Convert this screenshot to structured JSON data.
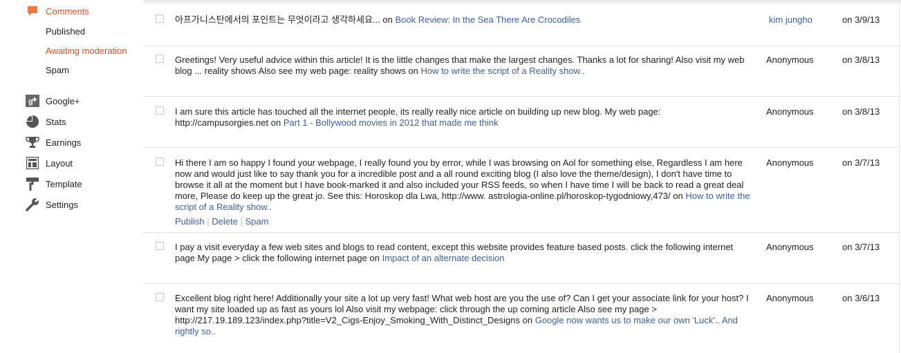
{
  "sidebar": {
    "comments_label": "Comments",
    "sub": [
      {
        "label": "Published",
        "active": false
      },
      {
        "label": "Awaiting moderation",
        "active": true
      },
      {
        "label": "Spam",
        "active": false
      }
    ],
    "items": [
      {
        "label": "Google+",
        "icon": "google-plus-icon"
      },
      {
        "label": "Stats",
        "icon": "pie-chart-icon"
      },
      {
        "label": "Earnings",
        "icon": "trophy-icon"
      },
      {
        "label": "Layout",
        "icon": "layout-icon"
      },
      {
        "label": "Template",
        "icon": "paint-roller-icon"
      },
      {
        "label": "Settings",
        "icon": "wrench-icon"
      }
    ]
  },
  "comments": [
    {
      "text": "아프가니스탄에서의 포인트는 무엇이라고 생각하세요...",
      "on": "on",
      "post": "Book Review: In the Sea There Are Crocodiles",
      "author": "kim jungho",
      "date": "on 3/9/13"
    },
    {
      "text": "Greetings! Very useful advice within this article! It is the little changes that make the largest changes. Thanks a lot for sharing! Also visit my web blog ... reality shows Also see my web page: reality shows",
      "on": "on",
      "post": "How to write the script of a Reality show..",
      "author": "Anonymous",
      "date": "on 3/8/13"
    },
    {
      "text": "I am sure this article has touched all the internet people, its really really nice article on building up new blog. My web page: http://campusorgies.net",
      "on": "on",
      "post": "Part 1 - Bollywood movies in 2012 that made me think",
      "author": "Anonymous",
      "date": "on 3/8/13"
    },
    {
      "text": "Hi there I am so happy I found your webpage, I really found you by error, while I was browsing on Aol for something else, Regardless I am here now and would just like to say thank you for a incredible post and a all round exciting blog (I also love the theme/design), I don't have time to browse it all at the moment but I have book-marked it and also included your RSS feeds, so when I have time I will be back to read a great deal more, Please do keep up the great jo. See this: Horoskop dla Lwa, http://www. astrologia-online.pl/horoskop-tygodniowy,473/",
      "on": "on",
      "post": "How to write the script of a Reality show..",
      "author": "Anonymous",
      "date": "on 3/7/13"
    },
    {
      "text": "I pay a visit everyday a few web sites and blogs to read content, except this website provides feature based posts. click the following internet page My page > click the following internet page",
      "on": "on",
      "post": "Impact of an alternate decision",
      "author": "Anonymous",
      "date": "on 3/7/13"
    },
    {
      "text": "Excellent blog right here! Additionally your site a lot up very fast! What web host are you the use of? Can I get your associate link for your host? I want my site loaded up as fast as yours lol Also visit my webpage: click through the up coming article Also see my page > http://217.19.189.123/index.php?title=V2_Cigs-Enjoy_Smoking_With_Distinct_Designs",
      "on": "on",
      "post": "Google now wants us to make our own 'Luck'.. And rightly so..",
      "author": "Anonymous",
      "date": "on 3/6/13"
    }
  ],
  "actions": {
    "publish": "Publish",
    "sep": "|",
    "delete": "Delete",
    "spam": "Spam"
  },
  "colors": {
    "accent": "#dd4b20",
    "link": "#3a5ea7",
    "icon": "#555555",
    "comments_icon": "#f07a3a"
  }
}
